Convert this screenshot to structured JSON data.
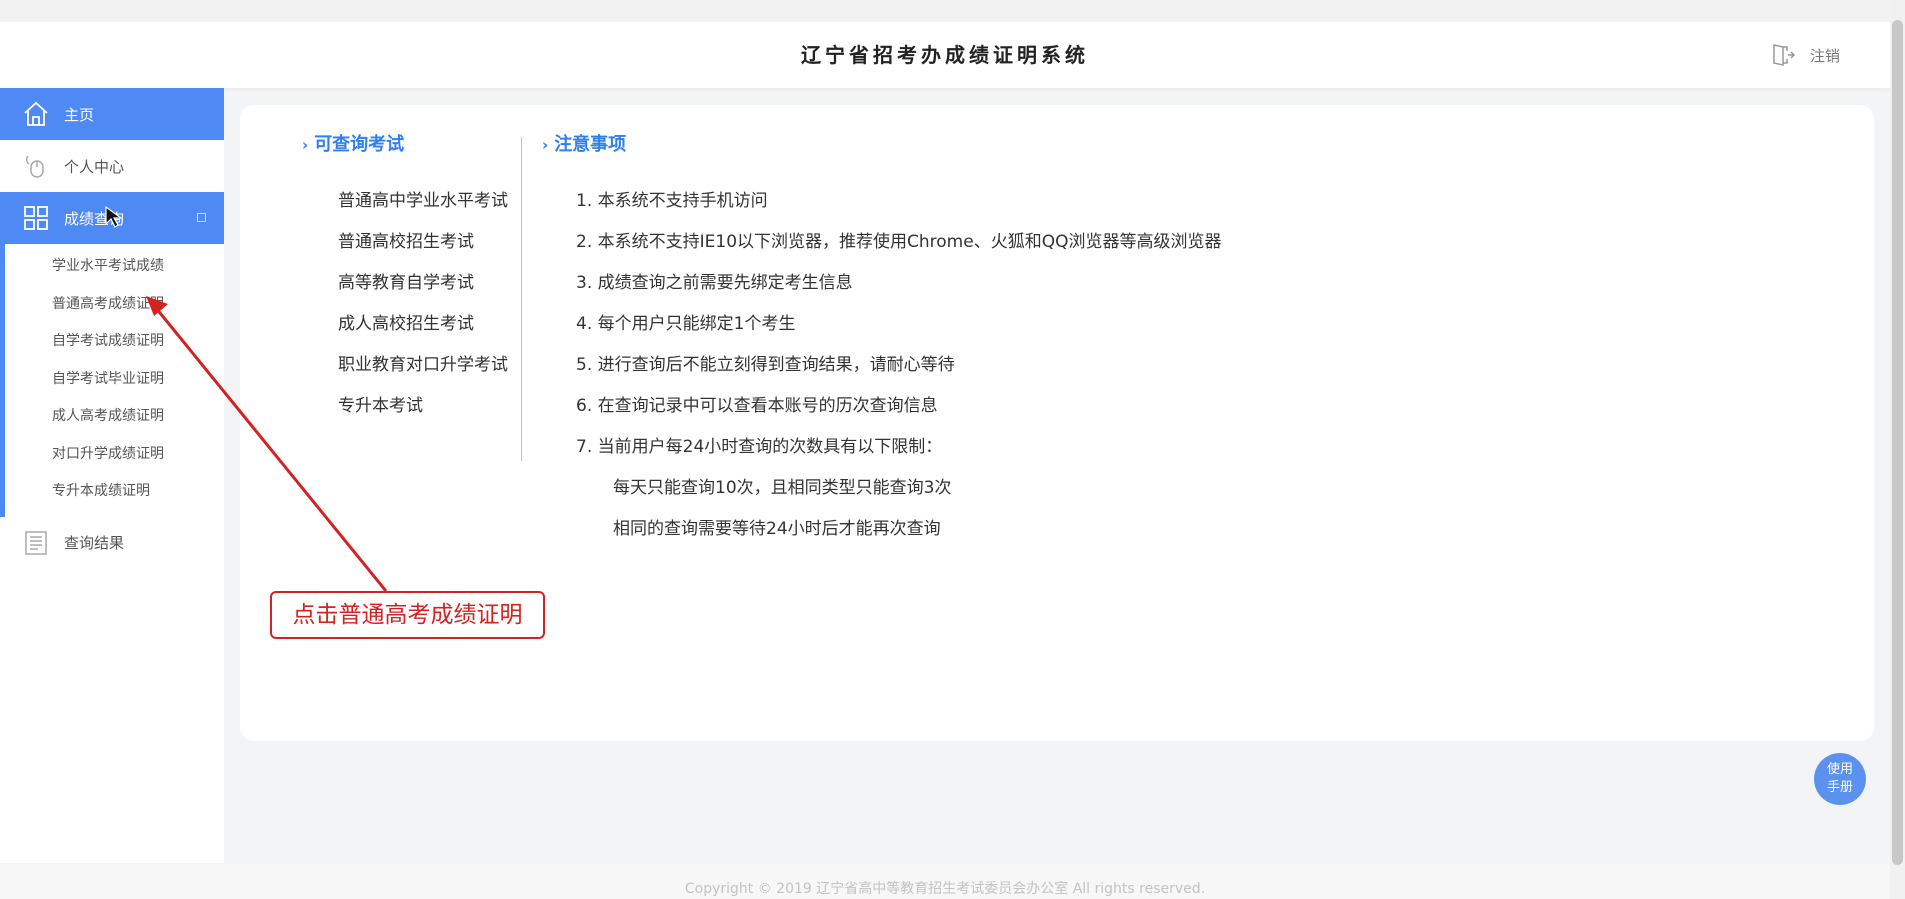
{
  "header": {
    "title": "辽宁省招考办成绩证明系统",
    "logout_label": "注销"
  },
  "sidebar": {
    "items": [
      {
        "label": "主页",
        "icon": "home-icon"
      },
      {
        "label": "个人中心",
        "icon": "mouse-icon"
      },
      {
        "label": "成绩查询",
        "icon": "grid-icon"
      },
      {
        "label": "查询结果",
        "icon": "document-icon"
      }
    ],
    "submenu": [
      "学业水平考试成绩",
      "普通高考成绩证明",
      "自学考试成绩证明",
      "自学考试毕业证明",
      "成人高考成绩证明",
      "对口升学成绩证明",
      "专升本成绩证明"
    ]
  },
  "main": {
    "exams_title": "可查询考试",
    "exams": [
      "普通高中学业水平考试",
      "普通高校招生考试",
      "高等教育自学考试",
      "成人高校招生考试",
      "职业教育对口升学考试",
      "专升本考试"
    ],
    "notes_title": "注意事项",
    "notes": [
      "1. 本系统不支持手机访问",
      "2. 本系统不支持IE10以下浏览器，推荐使用Chrome、火狐和QQ浏览器等高级浏览器",
      "3. 成绩查询之前需要先绑定考生信息",
      "4. 每个用户只能绑定1个考生",
      "5. 进行查询后不能立刻得到查询结果，请耐心等待",
      "6. 在查询记录中可以查看本账号的历次查询信息",
      "7. 当前用户每24小时查询的次数具有以下限制："
    ],
    "sub_notes": [
      "每天只能查询10次，且相同类型只能查询3次",
      "相同的查询需要等待24小时后才能再次查询"
    ]
  },
  "annotation": {
    "text": "点击普通高考成绩证明"
  },
  "help": {
    "line1": "使用",
    "line2": "手册"
  },
  "footer": {
    "copyright": "Copyright © 2019 辽宁省高中等教育招生考试委员会办公室 All rights reserved."
  },
  "colors": {
    "accent": "#4f8af4",
    "title_blue": "#2f7ff0",
    "annotation_red": "#d32222"
  }
}
